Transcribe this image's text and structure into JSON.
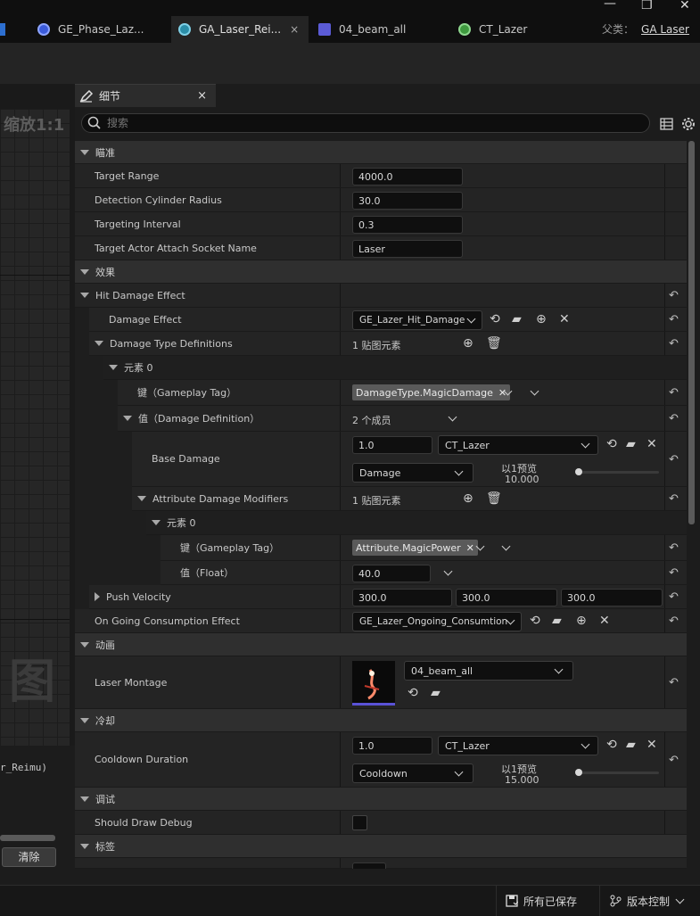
{
  "window": {
    "tabs": [
      {
        "label": "GE_Phase_Laz...",
        "icon": "gameplay-effect-icon",
        "color": "#3b5bdb"
      },
      {
        "label": "GA_Laser_Rei...",
        "icon": "gameplay-ability-icon",
        "color": "#2b8ea8",
        "active": true
      },
      {
        "label": "04_beam_all",
        "icon": "anim-montage-icon",
        "color": "#5b5bd6"
      },
      {
        "label": "CT_Lazer",
        "icon": "curve-table-icon",
        "color": "#3f9a3f"
      }
    ],
    "tab_close": "×",
    "parent_label": "父类：",
    "parent_value": "GA Laser",
    "window_controls": {
      "minimize": "—",
      "restore": "❐",
      "close": "✕"
    }
  },
  "left_panel": {
    "zoom_label": "缩放1:1",
    "watermark": "图",
    "log_text": "r_Reimu)",
    "clear_button": "清除"
  },
  "details": {
    "tab_title": "细节",
    "tab_close": "×",
    "search_placeholder": "搜索",
    "categories": {
      "aiming": "瞄准",
      "effects": "效果",
      "animation": "动画",
      "cooldown": "冷却",
      "debug": "调试",
      "tags": "标签"
    },
    "aiming": {
      "target_range": {
        "label": "Target Range",
        "value": "4000.0"
      },
      "detection_radius": {
        "label": "Detection Cylinder Radius",
        "value": "30.0"
      },
      "targeting_interval": {
        "label": "Targeting Interval",
        "value": "0.3"
      },
      "socket_name": {
        "label": "Target Actor Attach Socket Name",
        "value": "Laser"
      }
    },
    "effects": {
      "hit_damage_effect": "Hit Damage Effect",
      "damage_effect": {
        "label": "Damage Effect",
        "value": "GE_Lazer_Hit_Damage"
      },
      "damage_type_defs": {
        "label": "Damage Type Definitions",
        "value": "1 贴图元素"
      },
      "element0": "元素 0",
      "key_tag": {
        "label": "键（Gameplay Tag）",
        "value": "DamageType.MagicDamage"
      },
      "value_def": {
        "label": "值（Damage Definition）",
        "value": "2 个成员"
      },
      "base_damage": {
        "label": "Base Damage",
        "value": "1.0",
        "curve_table": "CT_Lazer",
        "row": "Damage",
        "preview_label": "以1预览",
        "preview_value": "10.000",
        "preview_level": 0
      },
      "attr_modifiers": {
        "label": "Attribute Damage Modifiers",
        "value": "1 贴图元素"
      },
      "mod_element0": "元素 0",
      "mod_key": {
        "label": "键（Gameplay Tag）",
        "value": "Attribute.MagicPower"
      },
      "mod_value": {
        "label": "值（Float）",
        "value": "40.0"
      },
      "push_velocity": {
        "label": "Push Velocity",
        "x": "300.0",
        "y": "300.0",
        "z": "300.0"
      },
      "ongoing_effect": {
        "label": "On Going Consumption Effect",
        "value": "GE_Lazer_Ongoing_Consumtion"
      }
    },
    "animation": {
      "laser_montage": {
        "label": "Laser Montage",
        "value": "04_beam_all"
      }
    },
    "cooldown": {
      "duration": {
        "label": "Cooldown Duration",
        "value": "1.0",
        "curve_table": "CT_Lazer",
        "row": "Cooldown",
        "preview_label": "以1预览",
        "preview_value": "15.000",
        "preview_level": 0
      }
    },
    "debug": {
      "should_draw": {
        "label": "Should Draw Debug",
        "checked": false
      }
    }
  },
  "status_bar": {
    "saved": "所有已保存",
    "source_control": "版本控制"
  },
  "colors": {
    "panel_bg": "#242424",
    "category_bg": "#2f2f2f",
    "input_bg": "#0f0f0f"
  }
}
